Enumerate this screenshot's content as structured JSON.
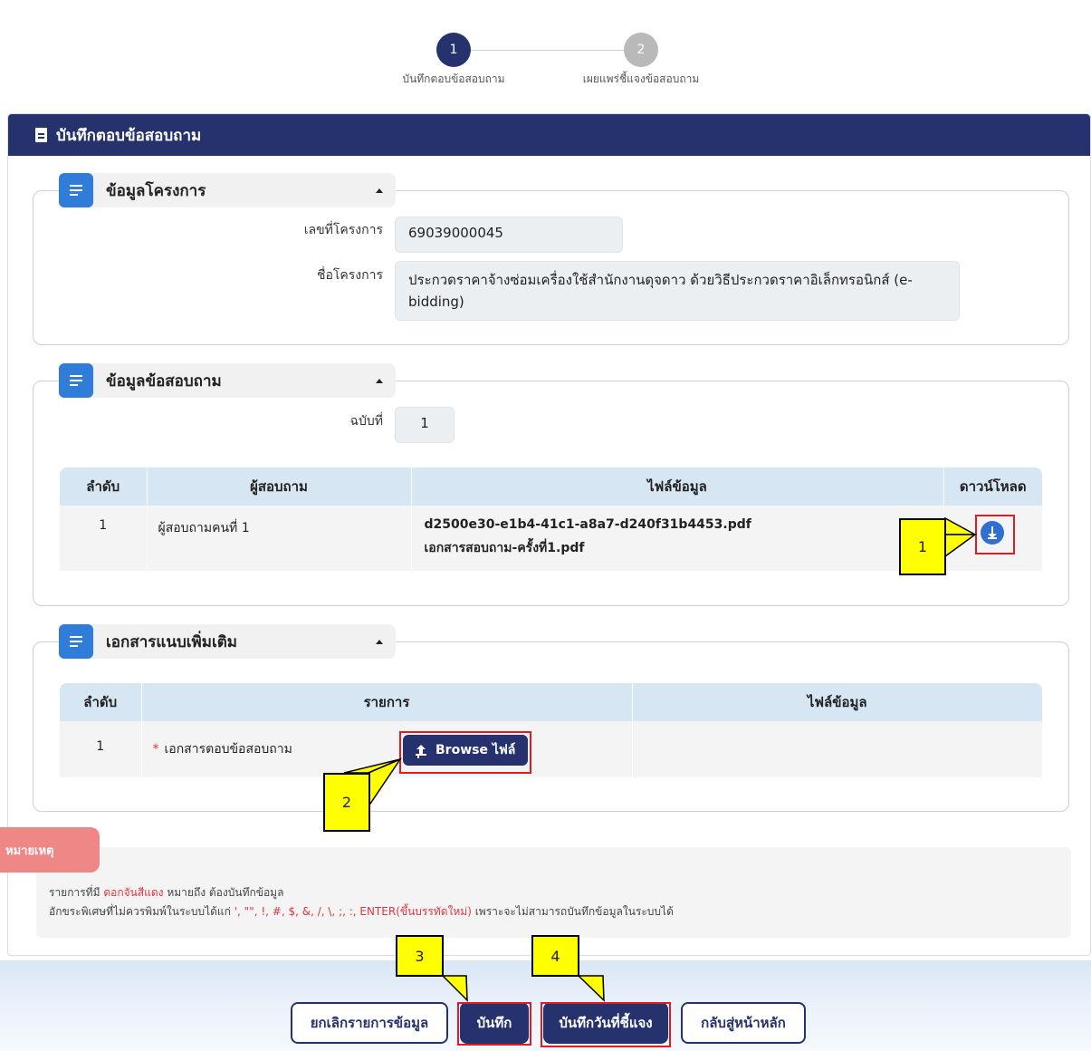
{
  "stepper": {
    "steps": [
      {
        "number": "1",
        "label": "บันทึกตอบข้อสอบถาม",
        "state": "active"
      },
      {
        "number": "2",
        "label": "เผยแพร่ชี้แจงข้อสอบถาม",
        "state": "inactive"
      }
    ]
  },
  "panel": {
    "title": "บันทึกตอบข้อสอบถาม"
  },
  "project_info": {
    "title": "ข้อมูลโครงการ",
    "project_no_label": "เลขที่โครงการ",
    "project_no_value": "69039000045",
    "project_name_label": "ชื่อโครงการ",
    "project_name_value": "ประกวดราคาจ้างซ่อมเครื่องใช้สำนักงานดุจดาว ด้วยวิธีประกวดราคาอิเล็กทรอนิกส์ (e-bidding)"
  },
  "inquiry_info": {
    "title": "ข้อมูลข้อสอบถาม",
    "issue_label": "ฉบับที่",
    "issue_value": "1",
    "table": {
      "headers": [
        "ลำดับ",
        "ผู้สอบถาม",
        "ไฟล์ข้อมูล",
        "ดาวน์โหลด"
      ],
      "rows": [
        {
          "no": "1",
          "inquirer": "ผู้สอบถามคนที่ 1",
          "file_name": "d2500e30-e1b4-41c1-a8a7-d240f31b4453.pdf",
          "file_desc": "เอกสารสอบถาม-ครั้งที่1.pdf"
        }
      ]
    }
  },
  "attachments": {
    "title": "เอกสารแนบเพิ่มเติม",
    "table": {
      "headers": [
        "ลำดับ",
        "รายการ",
        "ไฟล์ข้อมูล"
      ],
      "rows": [
        {
          "no": "1",
          "required_mark": "*",
          "item": "เอกสารตอบข้อสอบถาม",
          "browse_label": "Browse ไฟล์",
          "file": ""
        }
      ]
    }
  },
  "remark": {
    "tag": "หมายเหตุ",
    "line1_prefix": "รายการที่มี",
    "line1_red": "ดอกจันสีแดง",
    "line1_suffix": "หมายถึง ต้องบันทึกข้อมูล",
    "line2_prefix": "อักขระพิเศษที่ไม่ควรพิมพ์ในระบบได้แก่",
    "line2_red": "', \"\", !, #, $, &, /, \\, ;, :, ENTER(ขึ้นบรรทัดใหม่)",
    "line2_suffix": "เพราะจะไม่สามารถบันทึกข้อมูลในระบบได้"
  },
  "buttons": {
    "cancel": "ยกเลิกรายการข้อมูล",
    "save": "บันทึก",
    "save_clarify_date": "บันทึกวันที่ชี้แจง",
    "back_home": "กลับสู่หน้าหลัก"
  },
  "annotations": {
    "callouts": [
      "1",
      "2",
      "3",
      "4"
    ],
    "highlight_color": "#e01b22",
    "callout_color": "#ffff00"
  },
  "colors": {
    "primary": "#26326e",
    "accent_blue": "#2f7dd8",
    "table_header": "#d6e6f3",
    "required": "#e0353e",
    "remark_tag": "#f08787"
  }
}
